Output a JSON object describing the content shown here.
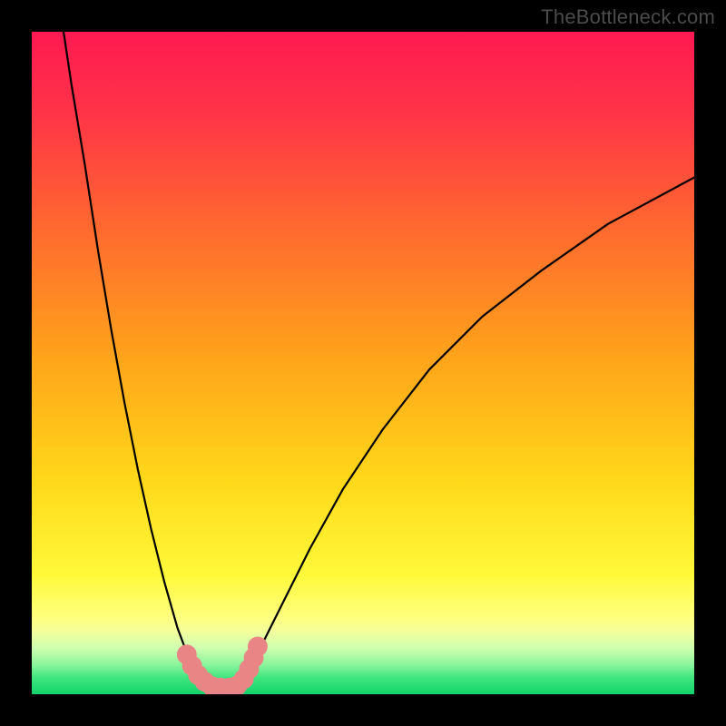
{
  "watermark": "TheBottleneck.com",
  "chart_data": {
    "type": "line",
    "title": "",
    "xlabel": "",
    "ylabel": "",
    "xlim": [
      0,
      100
    ],
    "ylim": [
      0,
      100
    ],
    "grid": false,
    "legend": false,
    "background_gradient_stops": [
      {
        "offset": 0.0,
        "color": "#ff1a51"
      },
      {
        "offset": 0.12,
        "color": "#ff3348"
      },
      {
        "offset": 0.3,
        "color": "#ff6a2f"
      },
      {
        "offset": 0.5,
        "color": "#ffa61a"
      },
      {
        "offset": 0.68,
        "color": "#ffd91a"
      },
      {
        "offset": 0.82,
        "color": "#fff93a"
      },
      {
        "offset": 0.885,
        "color": "#ffff80"
      },
      {
        "offset": 0.905,
        "color": "#f3ff9c"
      },
      {
        "offset": 0.93,
        "color": "#d0ffb0"
      },
      {
        "offset": 0.955,
        "color": "#8cf59c"
      },
      {
        "offset": 0.975,
        "color": "#40e680"
      },
      {
        "offset": 1.0,
        "color": "#12d36a"
      }
    ],
    "series": [
      {
        "name": "left-curve",
        "color": "#000000",
        "stroke_width": 2.2,
        "x": [
          4.8,
          6,
          8,
          10,
          12,
          14,
          16,
          18,
          20,
          22,
          23.5,
          25,
          26.3
        ],
        "y": [
          100,
          92,
          80,
          67,
          55,
          44,
          34,
          25,
          17,
          10,
          6,
          3,
          1.5
        ]
      },
      {
        "name": "right-curve",
        "color": "#000000",
        "stroke_width": 2.2,
        "x": [
          31.5,
          33,
          35,
          38,
          42,
          47,
          53,
          60,
          68,
          77,
          87,
          100
        ],
        "y": [
          1.5,
          4,
          8,
          14,
          22,
          31,
          40,
          49,
          57,
          64,
          71,
          78
        ]
      },
      {
        "name": "valley-floor",
        "color": "#000000",
        "stroke_width": 2.2,
        "x": [
          26.3,
          27.5,
          29,
          30.2,
          31.5
        ],
        "y": [
          1.5,
          1.0,
          0.9,
          1.0,
          1.5
        ]
      }
    ],
    "markers": [
      {
        "shape": "circle",
        "x": 23.4,
        "y": 6.0,
        "r": 1.5,
        "color": "#e98585"
      },
      {
        "shape": "circle",
        "x": 24.2,
        "y": 4.3,
        "r": 1.5,
        "color": "#e98585"
      },
      {
        "shape": "circle",
        "x": 25.1,
        "y": 2.9,
        "r": 1.5,
        "color": "#e98585"
      },
      {
        "shape": "circle",
        "x": 26.1,
        "y": 1.9,
        "r": 1.5,
        "color": "#e98585"
      },
      {
        "shape": "circle",
        "x": 27.2,
        "y": 1.2,
        "r": 1.5,
        "color": "#e98585"
      },
      {
        "shape": "circle",
        "x": 28.5,
        "y": 1.0,
        "r": 1.5,
        "color": "#e98585"
      },
      {
        "shape": "circle",
        "x": 29.8,
        "y": 1.0,
        "r": 1.5,
        "color": "#e98585"
      },
      {
        "shape": "circle",
        "x": 31.0,
        "y": 1.3,
        "r": 1.5,
        "color": "#e98585"
      },
      {
        "shape": "circle",
        "x": 32.0,
        "y": 2.3,
        "r": 1.5,
        "color": "#e98585"
      },
      {
        "shape": "circle",
        "x": 32.8,
        "y": 3.8,
        "r": 1.5,
        "color": "#e98585"
      },
      {
        "shape": "circle",
        "x": 33.5,
        "y": 5.5,
        "r": 1.5,
        "color": "#e98585"
      },
      {
        "shape": "circle",
        "x": 34.1,
        "y": 7.2,
        "r": 1.5,
        "color": "#e98585"
      }
    ]
  }
}
